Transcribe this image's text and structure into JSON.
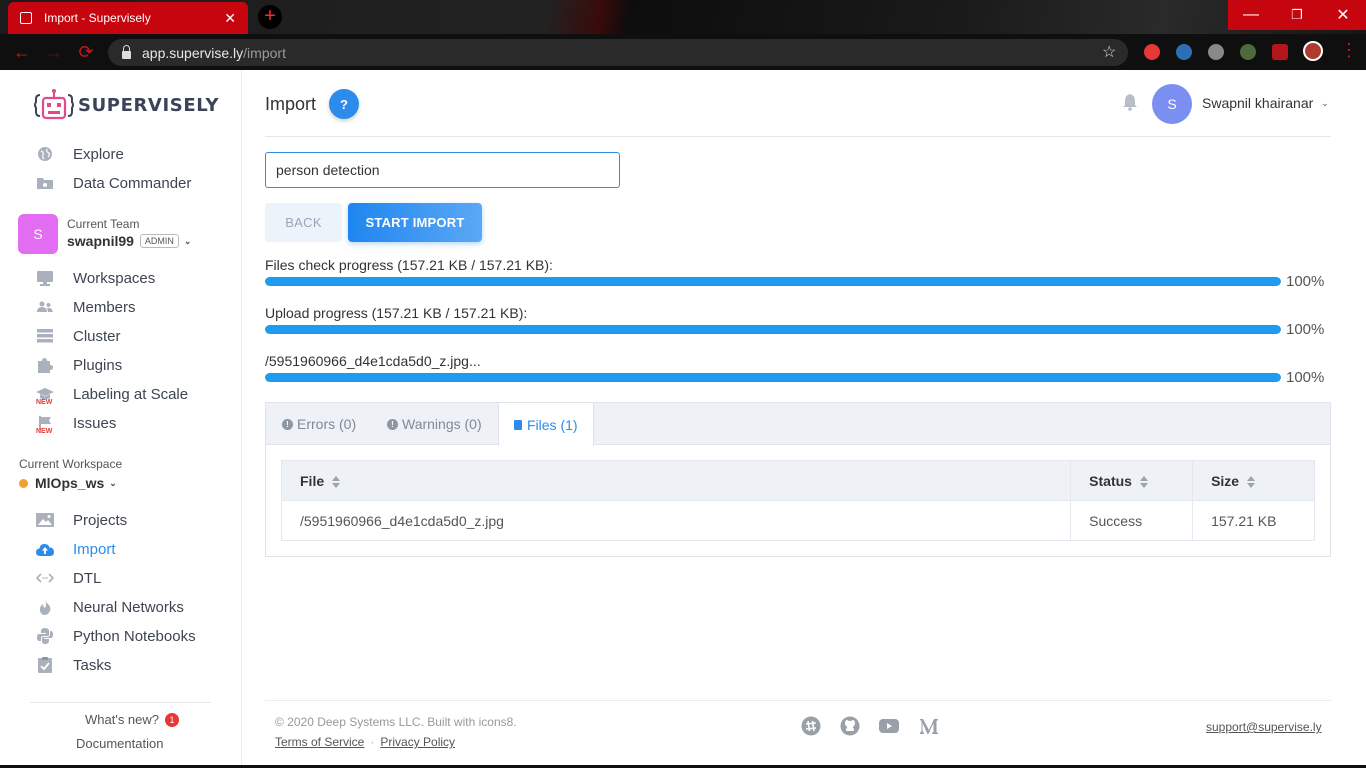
{
  "browser": {
    "tab_title": "Import - Supervisely",
    "tab_close": "✕",
    "new_tab": "+",
    "url_host": "app.supervise.ly",
    "url_path": "/import",
    "controls": {
      "minimize": "—",
      "restore": "❐",
      "close": "✕"
    },
    "nav": {
      "back": "←",
      "forward": "→",
      "reload": "⟳"
    },
    "star": "☆",
    "menu": "⋮"
  },
  "brand": {
    "name": "SUPERVISELY"
  },
  "sidebar": {
    "top_items": [
      {
        "label": "Explore",
        "icon": "globe-icon"
      },
      {
        "label": "Data Commander",
        "icon": "folder-icon"
      }
    ],
    "team": {
      "avatar_letter": "S",
      "label": "Current Team",
      "name": "swapnil99",
      "role": "ADMIN",
      "chevron": "⌄"
    },
    "team_items": [
      {
        "label": "Workspaces",
        "icon": "monitor-icon"
      },
      {
        "label": "Members",
        "icon": "users-icon"
      },
      {
        "label": "Cluster",
        "icon": "server-icon"
      },
      {
        "label": "Plugins",
        "icon": "puzzle-icon"
      },
      {
        "label": "Labeling at Scale",
        "icon": "graduation-cap-icon",
        "badge": "NEW"
      },
      {
        "label": "Issues",
        "icon": "flag-icon",
        "badge": "NEW"
      }
    ],
    "workspace": {
      "label": "Current Workspace",
      "name": "MlOps_ws",
      "chevron": "⌄"
    },
    "ws_items": [
      {
        "label": "Projects",
        "icon": "images-icon"
      },
      {
        "label": "Import",
        "icon": "cloud-upload-icon",
        "active": true
      },
      {
        "label": "DTL",
        "icon": "code-icon"
      },
      {
        "label": "Neural Networks",
        "icon": "fire-icon"
      },
      {
        "label": "Python Notebooks",
        "icon": "python-icon"
      },
      {
        "label": "Tasks",
        "icon": "checklist-icon"
      }
    ],
    "whats_new": {
      "label": "What's new?",
      "count": "1"
    },
    "documentation": "Documentation"
  },
  "header": {
    "title": "Import",
    "help": "?",
    "user": {
      "avatar_letter": "S",
      "name": "Swapnil khairanar",
      "chevron": "⌄"
    }
  },
  "form": {
    "project_name": "person detection",
    "back_label": "BACK",
    "start_label": "START IMPORT"
  },
  "progress": [
    {
      "label": "Files check progress (157.21 KB / 157.21 KB):",
      "percent_text": "100%",
      "fraction": 1.0
    },
    {
      "label": "Upload progress (157.21 KB / 157.21 KB):",
      "percent_text": "100%",
      "fraction": 1.0
    },
    {
      "label": "/5951960966_d4e1cda5d0_z.jpg...",
      "percent_text": "100%",
      "fraction": 1.0
    }
  ],
  "result_tabs": [
    {
      "label": "Errors (0)",
      "icon": "error-icon"
    },
    {
      "label": "Warnings (0)",
      "icon": "warning-icon"
    },
    {
      "label": "Files (1)",
      "icon": "file-icon",
      "active": true
    }
  ],
  "files_table": {
    "columns": [
      "File",
      "Status",
      "Size"
    ],
    "rows": [
      [
        "/5951960966_d4e1cda5d0_z.jpg",
        "Success",
        "157.21 KB"
      ]
    ]
  },
  "footer": {
    "copyright": "© 2020 Deep Systems LLC. Built with icons8.",
    "terms": "Terms of Service",
    "separator": "·",
    "privacy": "Privacy Policy",
    "social": [
      "slack-icon",
      "github-icon",
      "youtube-icon",
      "medium-icon"
    ],
    "support": "support@supervise.ly"
  },
  "colors": {
    "accent": "#2d8ceb",
    "progress": "#1e9aee",
    "browser_red": "#c6050f",
    "team_avatar": "#e26cf2",
    "user_avatar": "#7b8ef2",
    "workspace_dot": "#f0a030",
    "new_badge": "#e53935"
  }
}
